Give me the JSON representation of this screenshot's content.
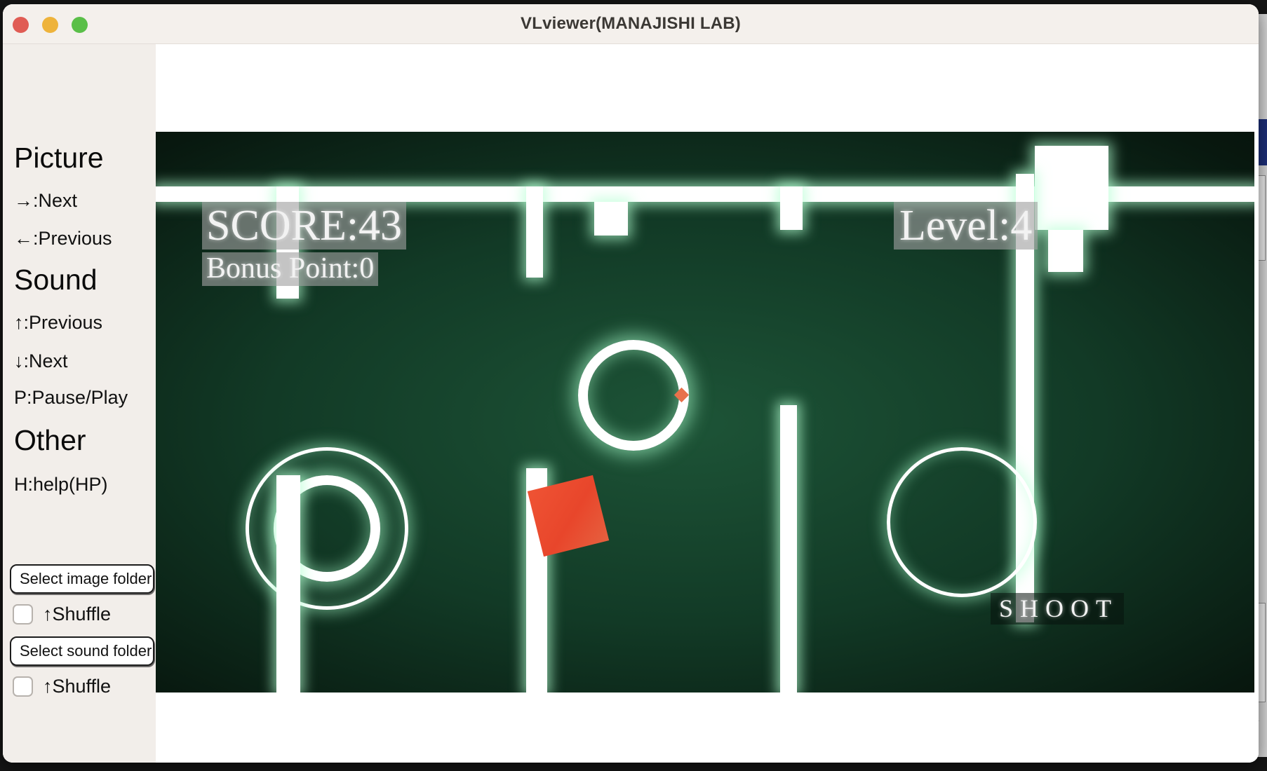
{
  "window": {
    "title": "VLviewer(MANAJISHI LAB)",
    "controls": {
      "close": "close-button",
      "minimize": "minimize-button",
      "maximize": "maximize-button"
    }
  },
  "sidebar": {
    "sections": [
      {
        "heading": "Picture",
        "items": [
          {
            "label": "→:Next"
          },
          {
            "label": "←:Previous"
          }
        ]
      },
      {
        "heading": "Sound",
        "items": [
          {
            "label": "↑:Previous"
          },
          {
            "label": "↓:Next"
          },
          {
            "label": "P:Pause/Play"
          }
        ]
      },
      {
        "heading": "Other",
        "items": [
          {
            "label": "H:help(HP)"
          }
        ]
      }
    ],
    "image_folder_button": "Select image folder",
    "image_shuffle_label": "↑Shuffle",
    "image_shuffle_checked": false,
    "sound_folder_button": "Select sound folder",
    "sound_shuffle_label": "↑Shuffle",
    "sound_shuffle_checked": false
  },
  "game": {
    "score_label": "SCORE:43",
    "bonus_label": "Bonus Point:0",
    "level_label": "Level:4",
    "shoot_label": "SHOOT",
    "score_value": 43,
    "bonus_value": 0,
    "level_value": 4,
    "colors": {
      "background_deep": "#040a06",
      "background_mid": "#123a26",
      "glow": "#b4ffd2",
      "player": "#ef5334",
      "pellet": "#e8714b"
    }
  },
  "backdrop": {
    "blue_chip_glyph": "≡",
    "mark_upper": "↙",
    "mark_lower": "↙"
  }
}
